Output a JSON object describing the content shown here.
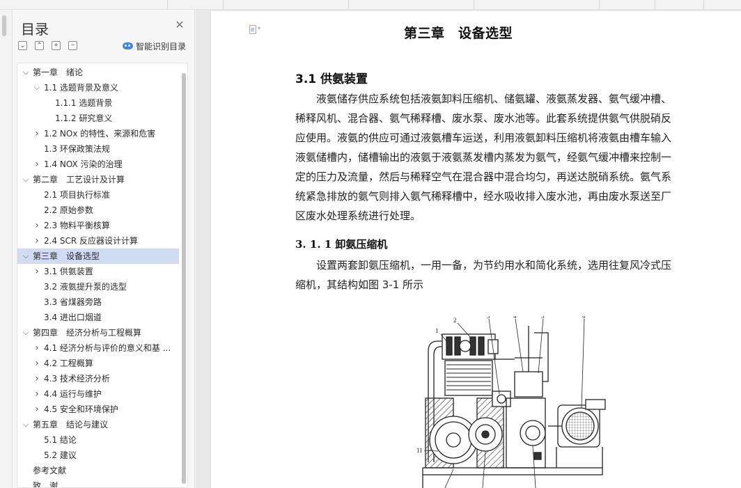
{
  "toc": {
    "title": "目录",
    "smart_label": "智能识别目录",
    "items": [
      {
        "level": 0,
        "label": "第一章　绪论",
        "arrow": "down",
        "active": false
      },
      {
        "level": 1,
        "label": "1.1  选题背景及意义",
        "arrow": "down",
        "active": false
      },
      {
        "level": 2,
        "label": "1.1.1  选题背景",
        "arrow": "",
        "active": false
      },
      {
        "level": 2,
        "label": "1.1.2  研究意义",
        "arrow": "",
        "active": false
      },
      {
        "level": 1,
        "label": "1.2 NOx 的特性、来源和危害",
        "arrow": "right",
        "active": false
      },
      {
        "level": 1,
        "label": "1.3  环保政策法规",
        "arrow": "",
        "active": false
      },
      {
        "level": 1,
        "label": "1.4 NOX 污染的治理",
        "arrow": "right",
        "active": false
      },
      {
        "level": 0,
        "label": "第二章　工艺设计及计算",
        "arrow": "down",
        "active": false
      },
      {
        "level": 1,
        "label": "2.1  项目执行标准",
        "arrow": "",
        "active": false
      },
      {
        "level": 1,
        "label": "2.2  原始参数",
        "arrow": "",
        "active": false
      },
      {
        "level": 1,
        "label": "2.3 物料平衡核算",
        "arrow": "right",
        "active": false
      },
      {
        "level": 1,
        "label": "2.4 SCR 反应器设计计算",
        "arrow": "right",
        "active": false
      },
      {
        "level": 0,
        "label": "第三章　设备选型",
        "arrow": "down",
        "active": true
      },
      {
        "level": 1,
        "label": "3.1  供氨装置",
        "arrow": "right",
        "active": false
      },
      {
        "level": 1,
        "label": "3.2  液氨提升泵的选型",
        "arrow": "",
        "active": false
      },
      {
        "level": 1,
        "label": "3.3  省煤器旁路",
        "arrow": "",
        "active": false
      },
      {
        "level": 1,
        "label": "3.4  进出口烟道",
        "arrow": "",
        "active": false
      },
      {
        "level": 0,
        "label": "第四章　经济分析与工程概算",
        "arrow": "down",
        "active": false
      },
      {
        "level": 1,
        "label": "4.1  经济分析与评价的意义和基 ...",
        "arrow": "right",
        "active": false
      },
      {
        "level": 1,
        "label": "4.2  工程概算",
        "arrow": "right",
        "active": false
      },
      {
        "level": 1,
        "label": "4.3  技术经济分析",
        "arrow": "right",
        "active": false
      },
      {
        "level": 1,
        "label": "4.4  运行与维护",
        "arrow": "right",
        "active": false
      },
      {
        "level": 1,
        "label": "4.5 安全和环境保护",
        "arrow": "right",
        "active": false
      },
      {
        "level": 0,
        "label": "第五章　结论与建议",
        "arrow": "down",
        "active": false
      },
      {
        "level": 1,
        "label": "5.1  结论",
        "arrow": "",
        "active": false
      },
      {
        "level": 1,
        "label": "5.2  建议",
        "arrow": "",
        "active": false
      },
      {
        "level": 0,
        "label": "参考文献",
        "arrow": "",
        "active": false
      },
      {
        "level": 0,
        "label": "致　谢",
        "arrow": "",
        "active": false
      }
    ]
  },
  "document": {
    "chapter_title": "第三章　设备选型",
    "section_title": "3.1  供氨装置",
    "para1_lines": [
      "　　液氨储存供应系统包括液氨卸料压缩机、储氨罐、液氨蒸发器、氨气缓冲槽、",
      "稀释风机、混合器、氨气稀释槽、废水泵、废水池等。此套系统提供氨气供脱硝反",
      "应使用。液氨的供应可通过液氨槽车运送，利用液氨卸料压缩机将液氨由槽车输入",
      "液氨储槽内，储槽输出的液氨于液氨蒸发槽内蒸发为氨气，经氨气缓冲槽来控制一",
      "定的压力及流量，然后与稀释空气在混合器中混合均匀，再送达脱硝系统。氨气系",
      "统紧急排放的氨气则排入氨气稀释槽中，经水吸收排入废水池，再由废水泵送至厂",
      "区废水处理系统进行处理。"
    ],
    "subsection_title": "3. 1. 1 卸氨压缩机",
    "para2_lines": [
      "　　设置两套卸氨压缩机，一用一备，为节约用水和简化系统，选用往复风冷式压",
      "缩机，其结构如图 3-1 所示"
    ],
    "figure_callouts": [
      "1",
      "2",
      "3",
      "4",
      "5",
      "6",
      "11"
    ]
  }
}
